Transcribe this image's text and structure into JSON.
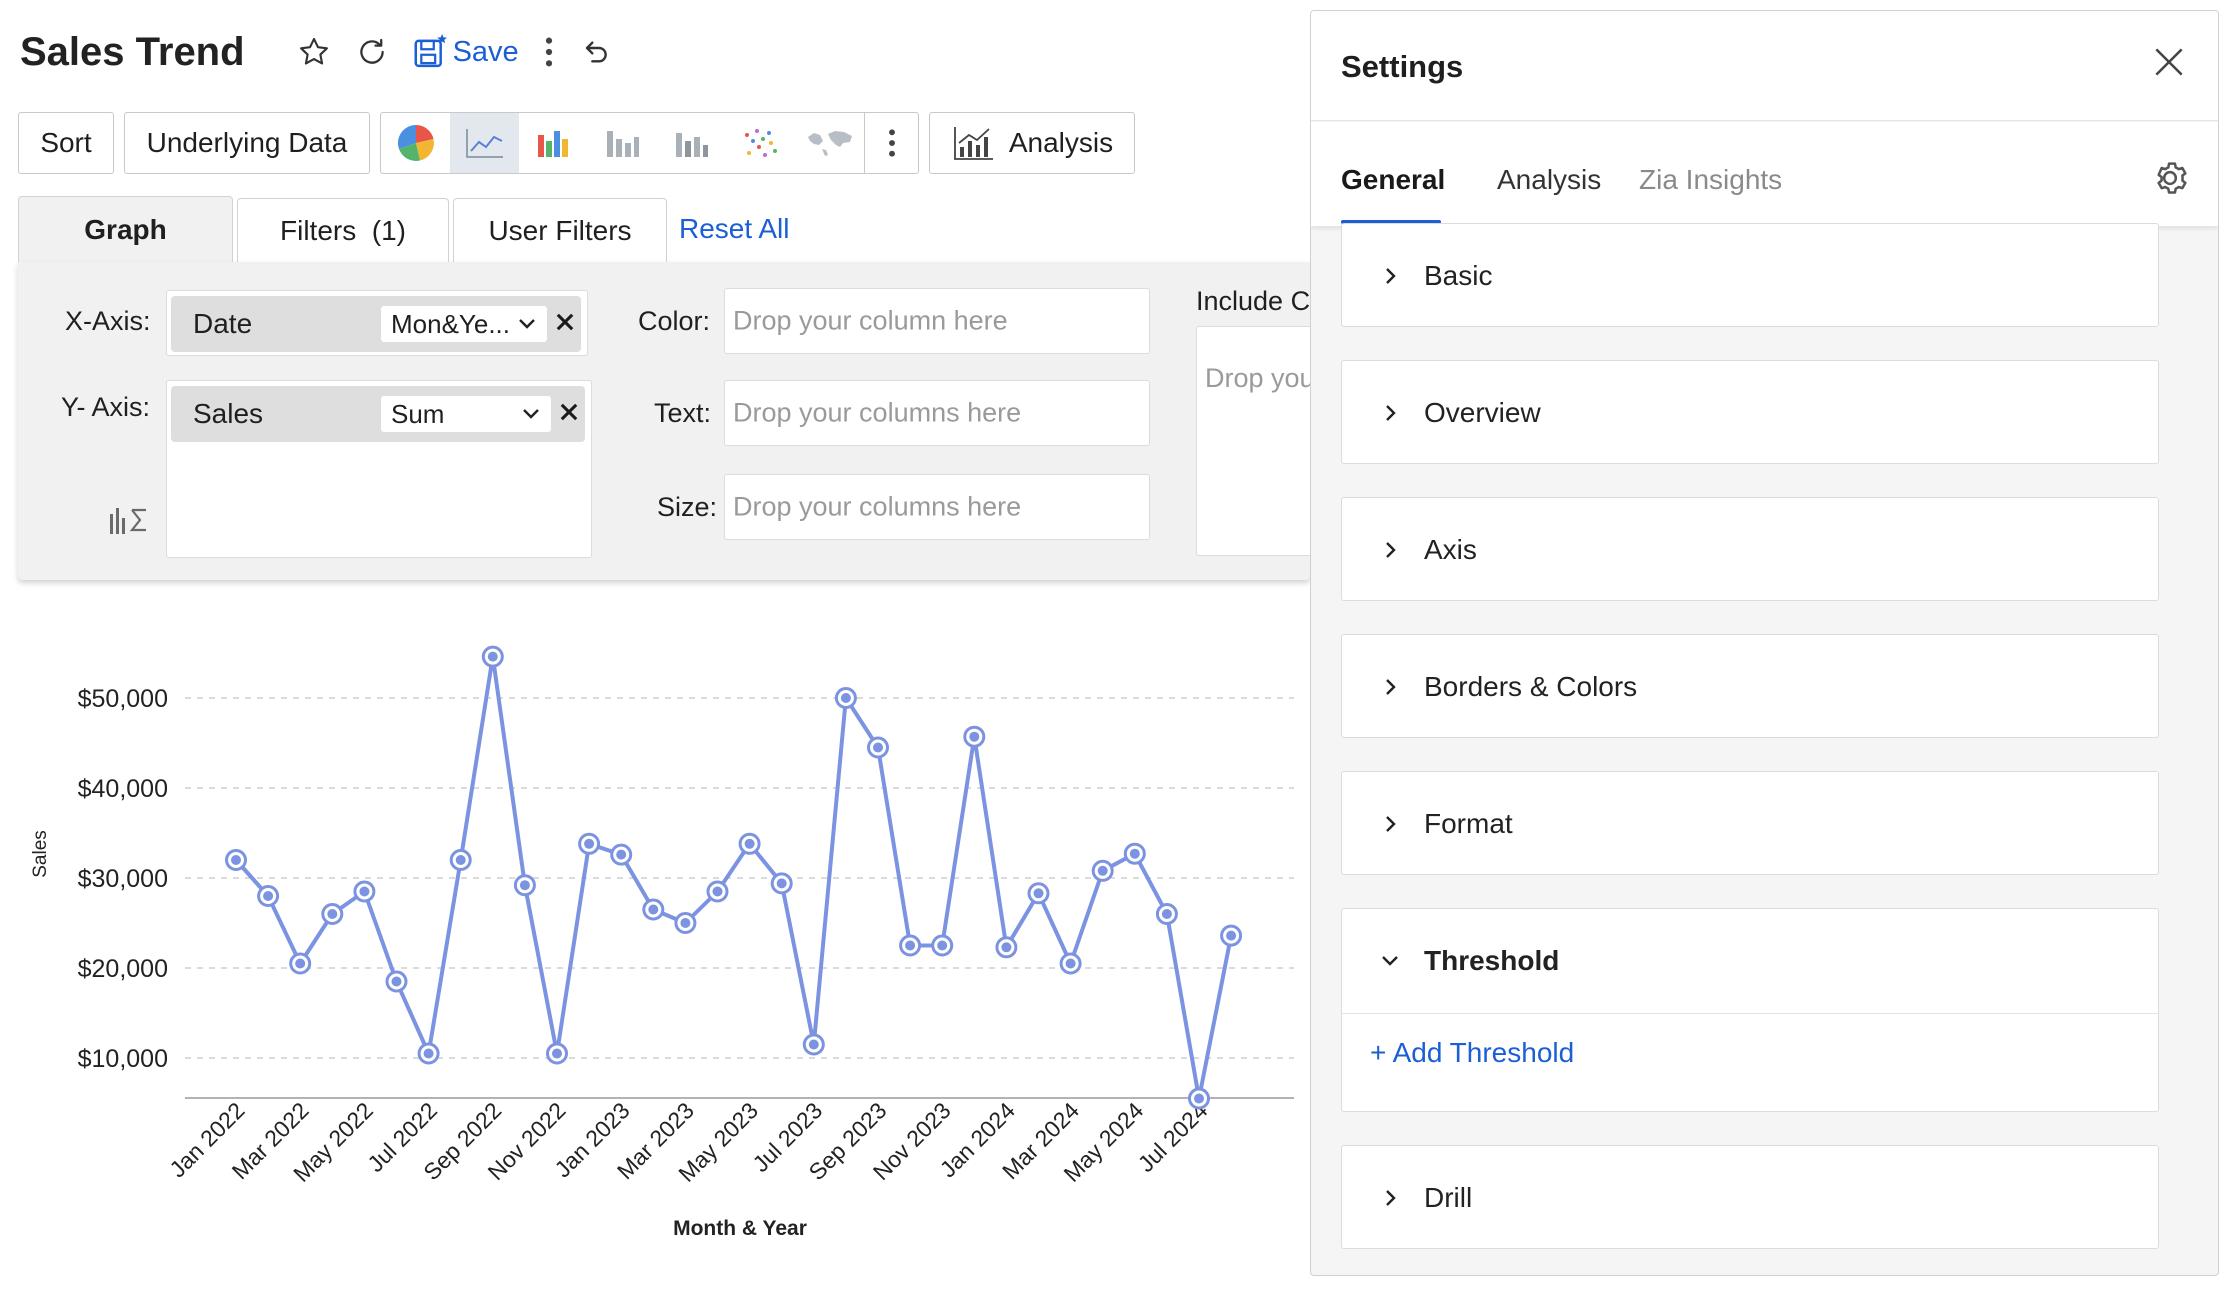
{
  "header": {
    "title": "Sales Trend",
    "save_label": "Save"
  },
  "toolbar": {
    "sort_label": "Sort",
    "underlying_data_label": "Underlying Data",
    "chart_types": [
      "pie-chart-icon",
      "line-chart-icon",
      "bar-chart-icon",
      "stacked-bar-icon",
      "combo-bar-icon",
      "scatter-icon",
      "map-icon"
    ],
    "active_chart_type": "line-chart-icon",
    "analysis_label": "Analysis"
  },
  "shelf_tabs": {
    "graph": "Graph",
    "filters": "Filters  (1)",
    "user_filters": "User Filters",
    "reset_all": "Reset All"
  },
  "shelf": {
    "x_axis_label": "X-Axis:",
    "x_axis_field": "Date",
    "x_axis_agg": "Mon&Ye...",
    "y_axis_label": "Y- Axis:",
    "y_axis_field": "Sales",
    "y_axis_agg": "Sum",
    "color_label": "Color:",
    "color_placeholder": "Drop your column here",
    "text_label": "Text:",
    "text_placeholder": "Drop your columns here",
    "size_label": "Size:",
    "size_placeholder": "Drop your columns here",
    "include_label": "Include C",
    "include_placeholder": "Drop you"
  },
  "chart_data": {
    "type": "line",
    "x": [
      "Jan 2022",
      "Feb 2022",
      "Mar 2022",
      "Apr 2022",
      "May 2022",
      "Jun 2022",
      "Jul 2022",
      "Aug 2022",
      "Sep 2022",
      "Oct 2022",
      "Nov 2022",
      "Dec 2022",
      "Jan 2023",
      "Feb 2023",
      "Mar 2023",
      "Apr 2023",
      "May 2023",
      "Jun 2023",
      "Jul 2023",
      "Aug 2023",
      "Sep 2023",
      "Oct 2023",
      "Nov 2023",
      "Dec 2023",
      "Jan 2024",
      "Feb 2024",
      "Mar 2024",
      "Apr 2024",
      "May 2024",
      "Jun 2024",
      "Jul 2024",
      "Aug 2024"
    ],
    "values": [
      32000,
      28000,
      20500,
      26000,
      28500,
      18500,
      10500,
      32000,
      54600,
      29200,
      10500,
      33800,
      32600,
      26500,
      25000,
      28500,
      33800,
      29400,
      11500,
      50000,
      44500,
      22500,
      22500,
      45700,
      22300,
      28300,
      20500,
      30800,
      32700,
      26000,
      5500,
      23600
    ],
    "x_tick_labels": [
      "Jan 2022",
      "Mar 2022",
      "May 2022",
      "Jul 2022",
      "Sep 2022",
      "Nov 2022",
      "Jan 2023",
      "Mar 2023",
      "May 2023",
      "Jul 2023",
      "Sep 2023",
      "Nov 2023",
      "Jan 2024",
      "Mar 2024",
      "May 2024",
      "Jul 2024"
    ],
    "y_ticks": [
      "$10,000",
      "$20,000",
      "$30,000",
      "$40,000",
      "$50,000"
    ],
    "y_tick_values": [
      10000,
      20000,
      30000,
      40000,
      50000
    ],
    "ylim": [
      0,
      60000
    ],
    "xlabel": "Month & Year",
    "ylabel": "Sales",
    "grid": true,
    "line_color": "#7b93e0"
  },
  "settings": {
    "title": "Settings",
    "tabs": [
      "General",
      "Analysis",
      "Zia Insights"
    ],
    "active_tab": "General",
    "sections": [
      "Basic",
      "Overview",
      "Axis",
      "Borders & Colors",
      "Format",
      "Threshold",
      "Drill"
    ],
    "expanded_section": "Threshold",
    "add_threshold_label": "+ Add Threshold"
  },
  "colors": {
    "accent": "#1a5fd6",
    "series": "#7b93e0"
  }
}
